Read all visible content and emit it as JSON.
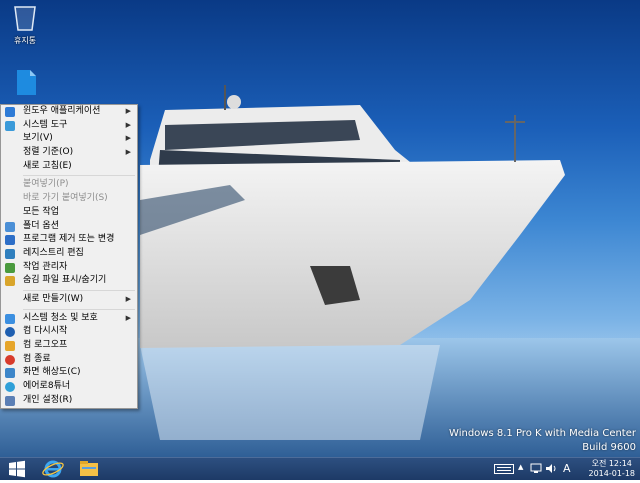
{
  "desktop": {
    "icons": [
      {
        "label": "휴지통",
        "icon": "recycle-bin-icon"
      },
      {
        "label": "",
        "icon": "folder-icon"
      }
    ]
  },
  "context_menu": {
    "items": [
      {
        "label": "윈도우 애플리케이션",
        "icon": "window-app-icon",
        "submenu": true,
        "disabled": false
      },
      {
        "label": "시스템 도구",
        "icon": "system-tools-icon",
        "submenu": true,
        "disabled": false
      },
      {
        "label": "보기(V)",
        "icon": "",
        "submenu": true,
        "disabled": false
      },
      {
        "label": "정렬 기준(O)",
        "icon": "",
        "submenu": true,
        "disabled": false
      },
      {
        "label": "새로 고침(E)",
        "icon": "",
        "submenu": false,
        "disabled": false
      },
      {
        "sep": true
      },
      {
        "label": "붙여넣기(P)",
        "icon": "",
        "submenu": false,
        "disabled": true
      },
      {
        "label": "바로 가기 붙여넣기(S)",
        "icon": "",
        "submenu": false,
        "disabled": true
      },
      {
        "label": "모든 작업",
        "icon": "",
        "submenu": false,
        "disabled": false
      },
      {
        "label": "폴더 옵션",
        "icon": "folder-options-icon",
        "submenu": false,
        "disabled": false
      },
      {
        "label": "프로그램 제거 또는 변경",
        "icon": "programs-icon",
        "submenu": false,
        "disabled": false
      },
      {
        "label": "레지스트리 편집",
        "icon": "registry-icon",
        "submenu": false,
        "disabled": false
      },
      {
        "label": "작업 관리자",
        "icon": "task-manager-icon",
        "submenu": false,
        "disabled": false
      },
      {
        "label": "숨김 파일 표시/숨기기",
        "icon": "hidden-files-icon",
        "submenu": false,
        "disabled": false
      },
      {
        "sep": true
      },
      {
        "label": "새로 만들기(W)",
        "icon": "",
        "submenu": true,
        "disabled": false
      },
      {
        "sep": true
      },
      {
        "label": "시스템 청소 및 보호",
        "icon": "shield-icon",
        "submenu": true,
        "disabled": false
      },
      {
        "label": "컴 다시시작",
        "icon": "restart-icon",
        "submenu": false,
        "disabled": false
      },
      {
        "label": "컴 로그오프",
        "icon": "logoff-icon",
        "submenu": false,
        "disabled": false
      },
      {
        "label": "컴 종료",
        "icon": "shutdown-icon",
        "submenu": false,
        "disabled": false
      },
      {
        "label": "화면 해상도(C)",
        "icon": "display-icon",
        "submenu": false,
        "disabled": false
      },
      {
        "label": "에어로8튜너",
        "icon": "aero-tuner-icon",
        "submenu": false,
        "disabled": false
      },
      {
        "label": "개인 설정(R)",
        "icon": "personalize-icon",
        "submenu": false,
        "disabled": false
      }
    ]
  },
  "watermark": {
    "line1": "Windows 8.1 Pro K with Media Center",
    "line2": "Build 9600"
  },
  "taskbar": {
    "buttons": [
      "start-icon",
      "internet-explorer-icon",
      "file-explorer-icon"
    ],
    "tray": {
      "keyboard": "keyboard-icon",
      "ime": "A",
      "time": "오전 12:14",
      "date": "2014-01-18"
    }
  }
}
